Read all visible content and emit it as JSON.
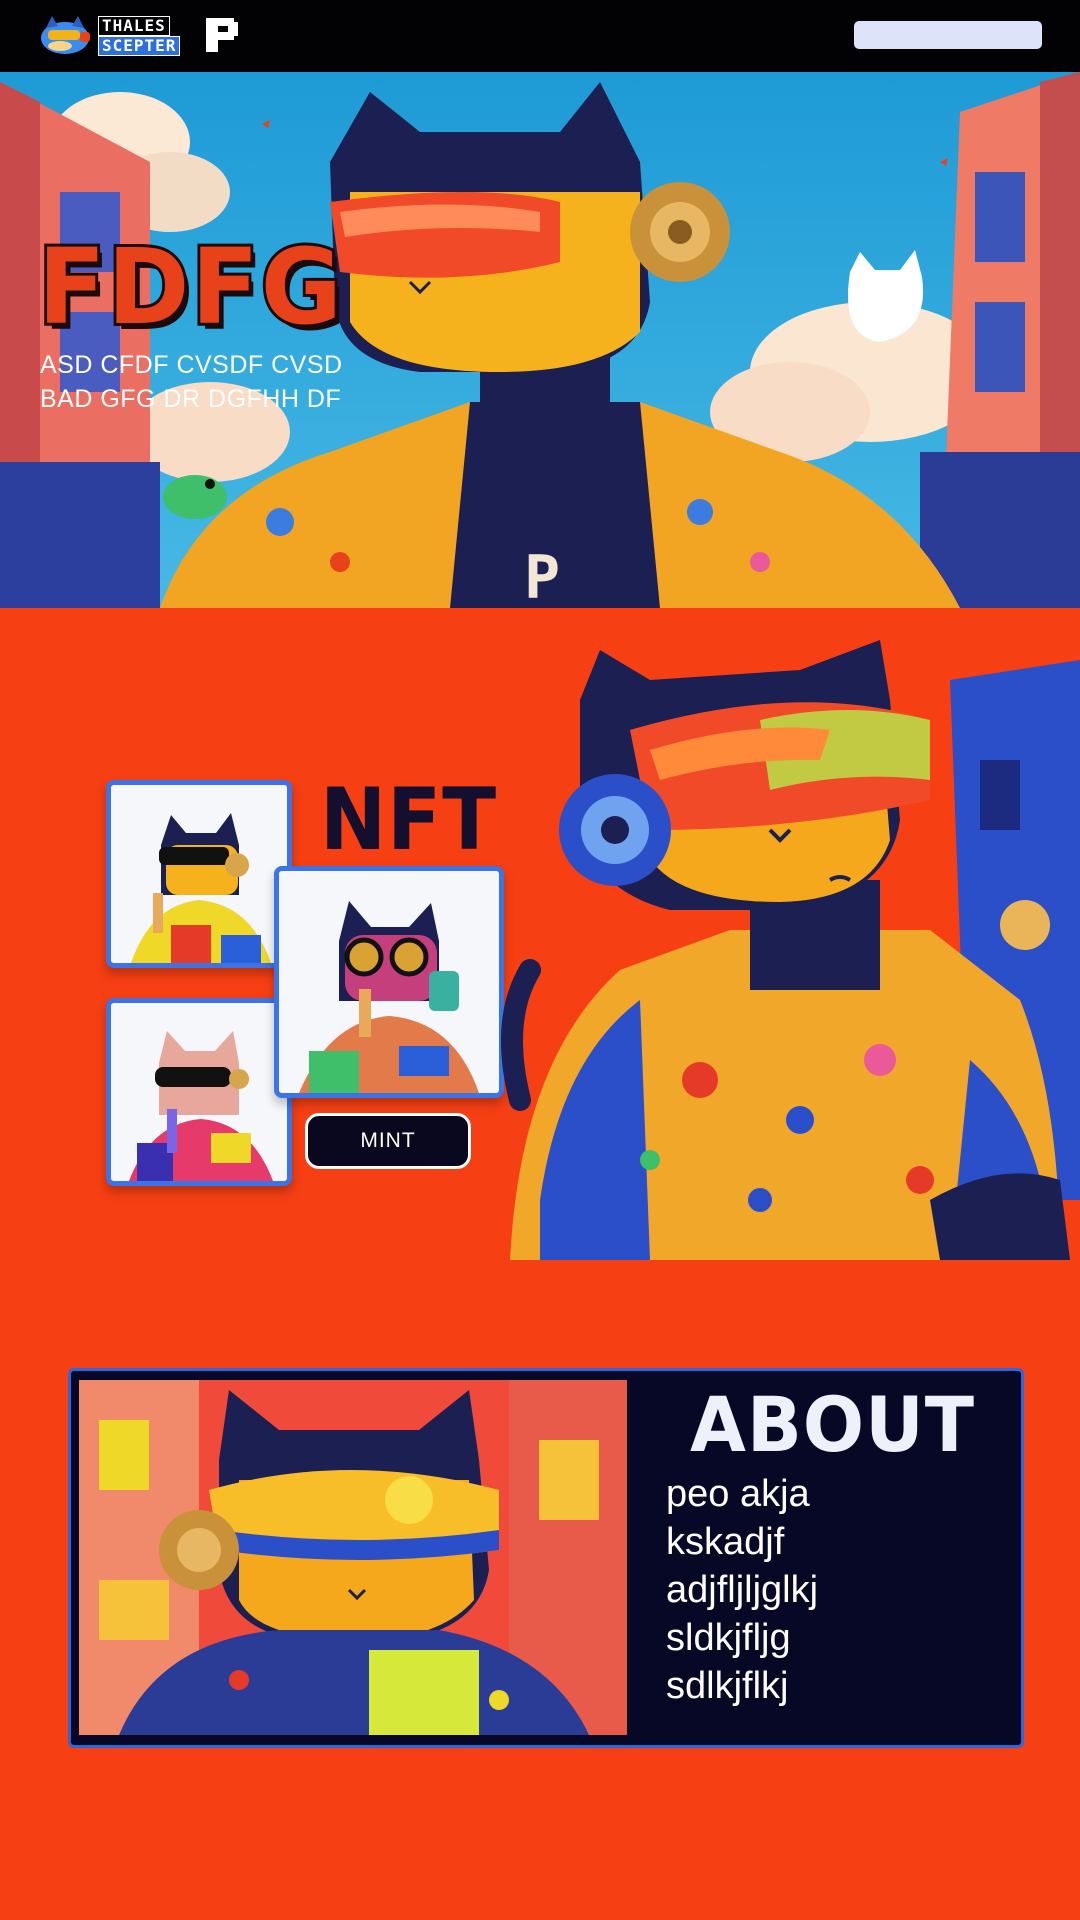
{
  "brand": {
    "logo_line1": "THALES",
    "logo_line2": "SCEPTER",
    "logo_glyph": "P"
  },
  "nav": {
    "search_value": "",
    "search_placeholder": ""
  },
  "hero": {
    "title": "FDFG",
    "subtitle_line1": "ASD CFDF CVSDF CVSD",
    "subtitle_line2": "BAD GFG DR DGFHH DF",
    "shirt_glyph": "P"
  },
  "nft": {
    "heading": "NFT",
    "cards": [
      {
        "name": "nft-card-1",
        "accent": "#e53a28"
      },
      {
        "name": "nft-card-2",
        "accent": "#c53f7c"
      },
      {
        "name": "nft-card-3",
        "accent": "#e8a79b"
      }
    ],
    "mint_label": "MINT"
  },
  "about": {
    "title": "ABOUT",
    "items": [
      "peo akja",
      "kskadjf",
      "adjfljljglkj",
      "sldkjfljg",
      "sdlkjflkj"
    ]
  },
  "colors": {
    "page_background": "#f63f13",
    "topbar": "#020205",
    "card_border": "#3a74e6",
    "about_panel": "#070726",
    "about_border": "#2e67d9",
    "mint_button": "#09081e"
  }
}
